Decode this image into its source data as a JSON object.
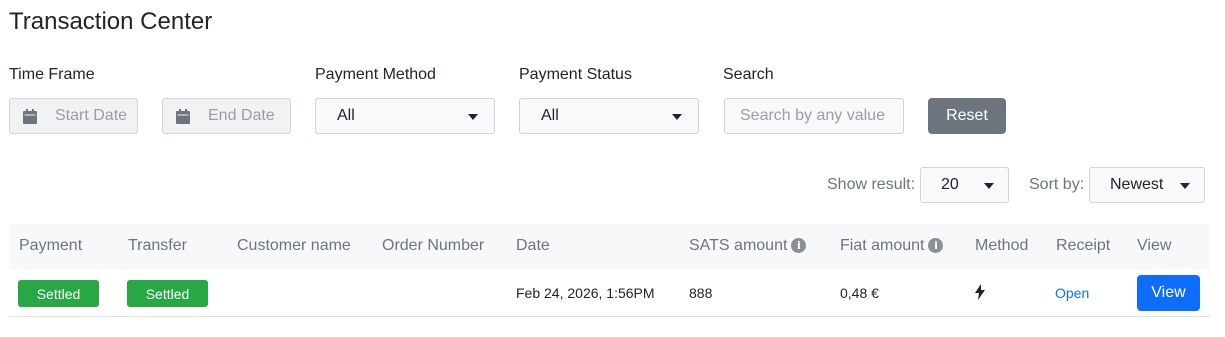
{
  "page": {
    "title": "Transaction Center"
  },
  "filters": {
    "time_frame_label": "Time Frame",
    "start_date_placeholder": "Start Date",
    "end_date_placeholder": "End Date",
    "payment_method_label": "Payment Method",
    "payment_method_value": "All",
    "payment_status_label": "Payment Status",
    "payment_status_value": "All",
    "search_label": "Search",
    "search_placeholder": "Search by any value",
    "reset_label": "Reset"
  },
  "controls": {
    "show_result_label": "Show result:",
    "show_result_value": "20",
    "sort_by_label": "Sort by:",
    "sort_by_value": "Newest"
  },
  "table": {
    "headers": {
      "payment": "Payment",
      "transfer": "Transfer",
      "customer_name": "Customer name",
      "order_number": "Order Number",
      "date": "Date",
      "sats_amount": "SATS amount",
      "fiat_amount": "Fiat amount",
      "method": "Method",
      "receipt": "Receipt",
      "view": "View"
    },
    "rows": [
      {
        "payment": "Settled",
        "transfer": "Settled",
        "customer_name": "",
        "order_number": "",
        "date": "Feb 24, 2026, 1:56PM",
        "sats_amount": "888",
        "fiat_amount": "0,48 €",
        "method_icon": "lightning-icon",
        "receipt": "Open",
        "view": "View"
      }
    ]
  },
  "colors": {
    "settled": "#28a745",
    "primary": "#0d6efd",
    "secondary": "#6c757d"
  }
}
